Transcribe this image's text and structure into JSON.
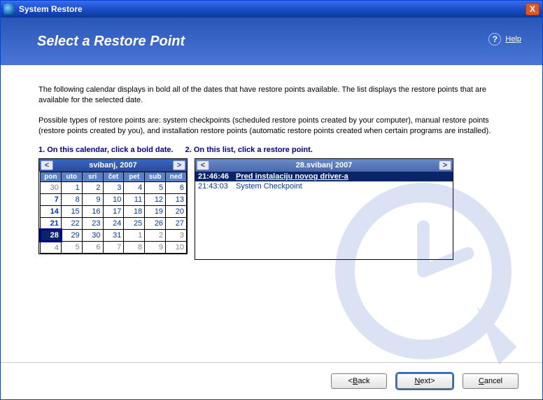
{
  "window": {
    "title": "System Restore",
    "close_x": "X"
  },
  "banner": {
    "heading": "Select a Restore Point",
    "help_label": "Help",
    "help_q": "?"
  },
  "body": {
    "para1": "The following calendar displays in bold all of the dates that have restore points available. The list displays the restore points that are available for the selected date.",
    "para2": "Possible types of restore points are: system checkpoints (scheduled restore points created by your computer), manual restore points (restore points created by you), and installation restore points (automatic restore points created when certain programs are installed).",
    "instr1": "1. On this calendar, click a bold date.",
    "instr2": "2. On this list, click a restore point."
  },
  "calendar": {
    "prev": "<",
    "next": ">",
    "month_label": "svibanj, 2007",
    "dow": [
      "pon",
      "uto",
      "sri",
      "čet",
      "pet",
      "sub",
      "ned"
    ],
    "weeks": [
      [
        {
          "d": "30",
          "o": true
        },
        {
          "d": "1"
        },
        {
          "d": "2"
        },
        {
          "d": "3"
        },
        {
          "d": "4"
        },
        {
          "d": "5"
        },
        {
          "d": "6"
        }
      ],
      [
        {
          "d": "7",
          "b": true
        },
        {
          "d": "8"
        },
        {
          "d": "9"
        },
        {
          "d": "10"
        },
        {
          "d": "11"
        },
        {
          "d": "12"
        },
        {
          "d": "13"
        }
      ],
      [
        {
          "d": "14",
          "b": true
        },
        {
          "d": "15"
        },
        {
          "d": "16"
        },
        {
          "d": "17"
        },
        {
          "d": "18"
        },
        {
          "d": "19"
        },
        {
          "d": "20"
        }
      ],
      [
        {
          "d": "21",
          "b": true
        },
        {
          "d": "22"
        },
        {
          "d": "23"
        },
        {
          "d": "24"
        },
        {
          "d": "25"
        },
        {
          "d": "26"
        },
        {
          "d": "27"
        }
      ],
      [
        {
          "d": "28",
          "b": true,
          "sel": true
        },
        {
          "d": "29"
        },
        {
          "d": "30"
        },
        {
          "d": "31"
        },
        {
          "d": "1",
          "o": true
        },
        {
          "d": "2",
          "o": true
        },
        {
          "d": "3",
          "o": true
        }
      ],
      [
        {
          "d": "4",
          "o": true
        },
        {
          "d": "5",
          "o": true
        },
        {
          "d": "6",
          "o": true
        },
        {
          "d": "7",
          "o": true
        },
        {
          "d": "8",
          "o": true
        },
        {
          "d": "9",
          "o": true
        },
        {
          "d": "10",
          "o": true
        }
      ]
    ]
  },
  "restore_list": {
    "prev": "<",
    "next": ">",
    "date_label": "28.svibanj 2007",
    "items": [
      {
        "time": "21:46:46",
        "desc": "Pred instalaciju novog driver-a",
        "selected": true
      },
      {
        "time": "21:43:03",
        "desc": "System Checkpoint",
        "selected": false
      }
    ]
  },
  "footer": {
    "back": "Back",
    "back_prefix": "< ",
    "next": "Next",
    "next_suffix": " >",
    "cancel": "Cancel"
  }
}
